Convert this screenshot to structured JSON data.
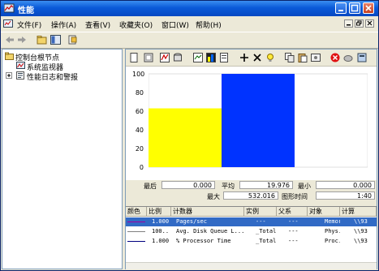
{
  "window": {
    "title": "性能"
  },
  "menu": {
    "items": [
      {
        "label": "文件(F)"
      },
      {
        "label": "操作(A)"
      },
      {
        "label": "查看(V)"
      },
      {
        "label": "收藏夹(O)"
      },
      {
        "label": "窗口(W)"
      },
      {
        "label": "帮助(H)"
      }
    ]
  },
  "tree": {
    "root": "控制台根节点",
    "items": [
      "系统监视器",
      "性能日志和警报"
    ]
  },
  "chart_data": {
    "type": "bar",
    "categories": [
      "Pages/sec",
      "Avg. Disk Queue Length"
    ],
    "values": [
      63,
      100
    ],
    "colors": [
      "#ffff00",
      "#0033ff"
    ],
    "ylim": [
      0,
      100
    ],
    "yticks": [
      "100",
      "80",
      "60",
      "40",
      "20",
      "0"
    ]
  },
  "stats": {
    "last_label": "最后",
    "last_value": "0.000",
    "avg_label": "平均",
    "avg_value": "19.976",
    "min_label": "最小",
    "min_value": "0.000",
    "max_label": "最大",
    "max_value": "532.016",
    "duration_label": "图形时间",
    "duration_value": "1:40"
  },
  "counters": {
    "headers": [
      "颜色",
      "比例",
      "计数器",
      "实例",
      "父系",
      "对象",
      "计算"
    ],
    "rows": [
      {
        "color": "#a000a0",
        "scale": "1.000",
        "counter": "Pages/sec",
        "instance": "---",
        "parent": "---",
        "object": "Memory",
        "computer": "\\\\93"
      },
      {
        "color": "#808080",
        "scale": "100...",
        "counter": "Avg. Disk Queue L...",
        "instance": "_Total",
        "parent": "---",
        "object": "Phys...",
        "computer": "\\\\93"
      },
      {
        "color": "#000080",
        "scale": "1.000",
        "counter": "% Processor Time",
        "instance": "_Total",
        "parent": "---",
        "object": "Proc...",
        "computer": "\\\\93"
      }
    ]
  }
}
